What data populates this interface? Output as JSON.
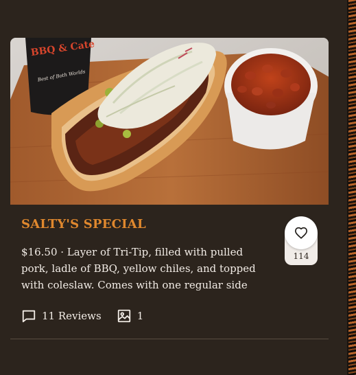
{
  "item": {
    "name": "SALTY'S SPECIAL",
    "description": "$16.50 · Layer of Tri-Tip, filled with pulled pork, ladle of BBQ, yellow chiles, and topped with coleslaw. Comes with one regular side",
    "likes": "114",
    "reviews_label": "11 Reviews",
    "photos_count": "1"
  },
  "photo": {
    "cup_text_top": "BBQ & Cate",
    "cup_text_bottom": "Best of Both Worlds"
  },
  "colors": {
    "background": "#2c241d",
    "title": "#e0882e",
    "text": "#f2ece6",
    "divider": "#5a4d42"
  },
  "icons": {
    "like": "heart-icon",
    "reviews": "chat-bubble-icon",
    "photos": "image-icon"
  }
}
